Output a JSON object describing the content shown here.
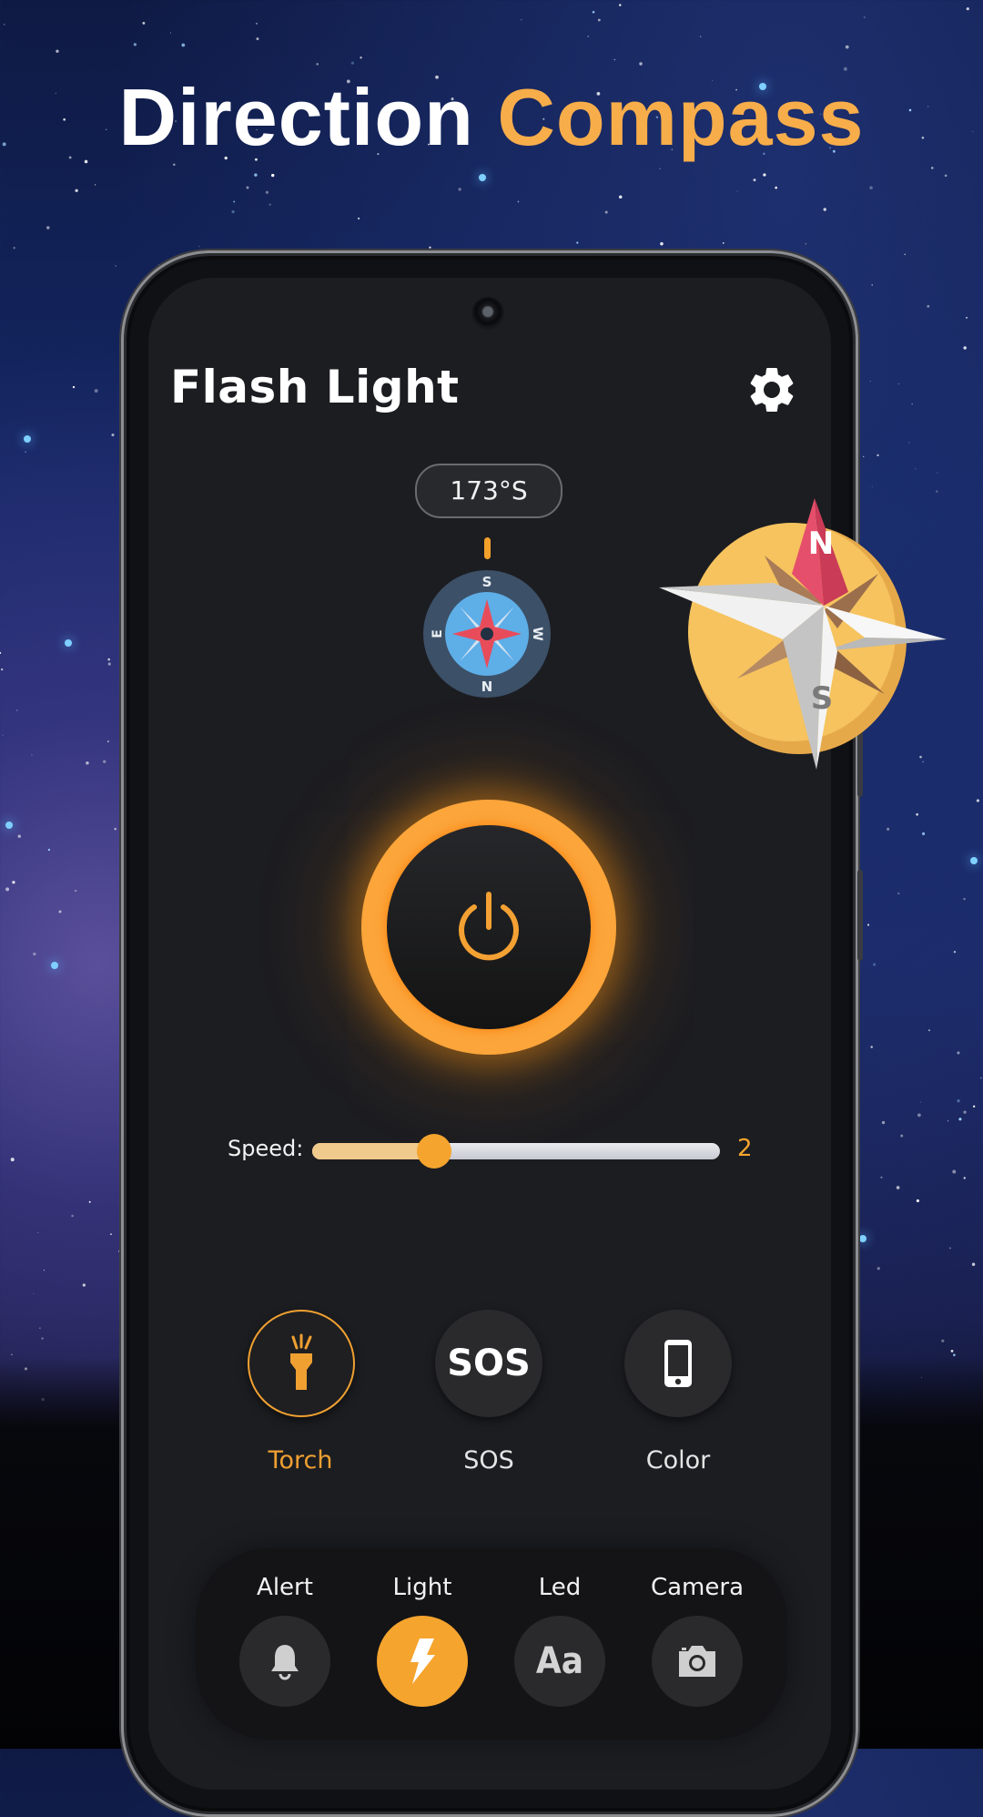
{
  "hero": {
    "title_part1": "Direction",
    "title_part2": "Compass",
    "accent_color": "#f7ad4a"
  },
  "app": {
    "title": "Flash Light",
    "settings_icon": "gear-icon"
  },
  "compass": {
    "heading_readout": "173°S",
    "heading_degrees": 173,
    "mini_compass_letters": {
      "top": "S",
      "right": "W",
      "bottom": "N",
      "left": "E"
    },
    "decor_letters": {
      "north": "N",
      "south": "S"
    }
  },
  "power_button": {
    "icon": "power-icon",
    "state": "on",
    "glow_color": "#fba53a"
  },
  "speed": {
    "label": "Speed:",
    "value": "2",
    "fraction": 0.3
  },
  "modes": [
    {
      "label": "Torch",
      "icon": "torch-icon",
      "active": true
    },
    {
      "label": "SOS",
      "icon": "sos-icon",
      "icon_text": "SOS",
      "active": false
    },
    {
      "label": "Color",
      "icon": "phone-icon",
      "active": false
    }
  ],
  "bottom_nav": [
    {
      "label": "Alert",
      "icon": "bell-icon",
      "active": false
    },
    {
      "label": "Light",
      "icon": "lightning-icon",
      "active": true
    },
    {
      "label": "Led",
      "icon": "text-icon",
      "icon_text": "Aa",
      "active": false
    },
    {
      "label": "Camera",
      "icon": "camera-icon",
      "active": false
    }
  ],
  "colors": {
    "accent": "#f5a42e",
    "screen_bg": "#1c1d21",
    "button_bg": "#2a2a2c"
  }
}
